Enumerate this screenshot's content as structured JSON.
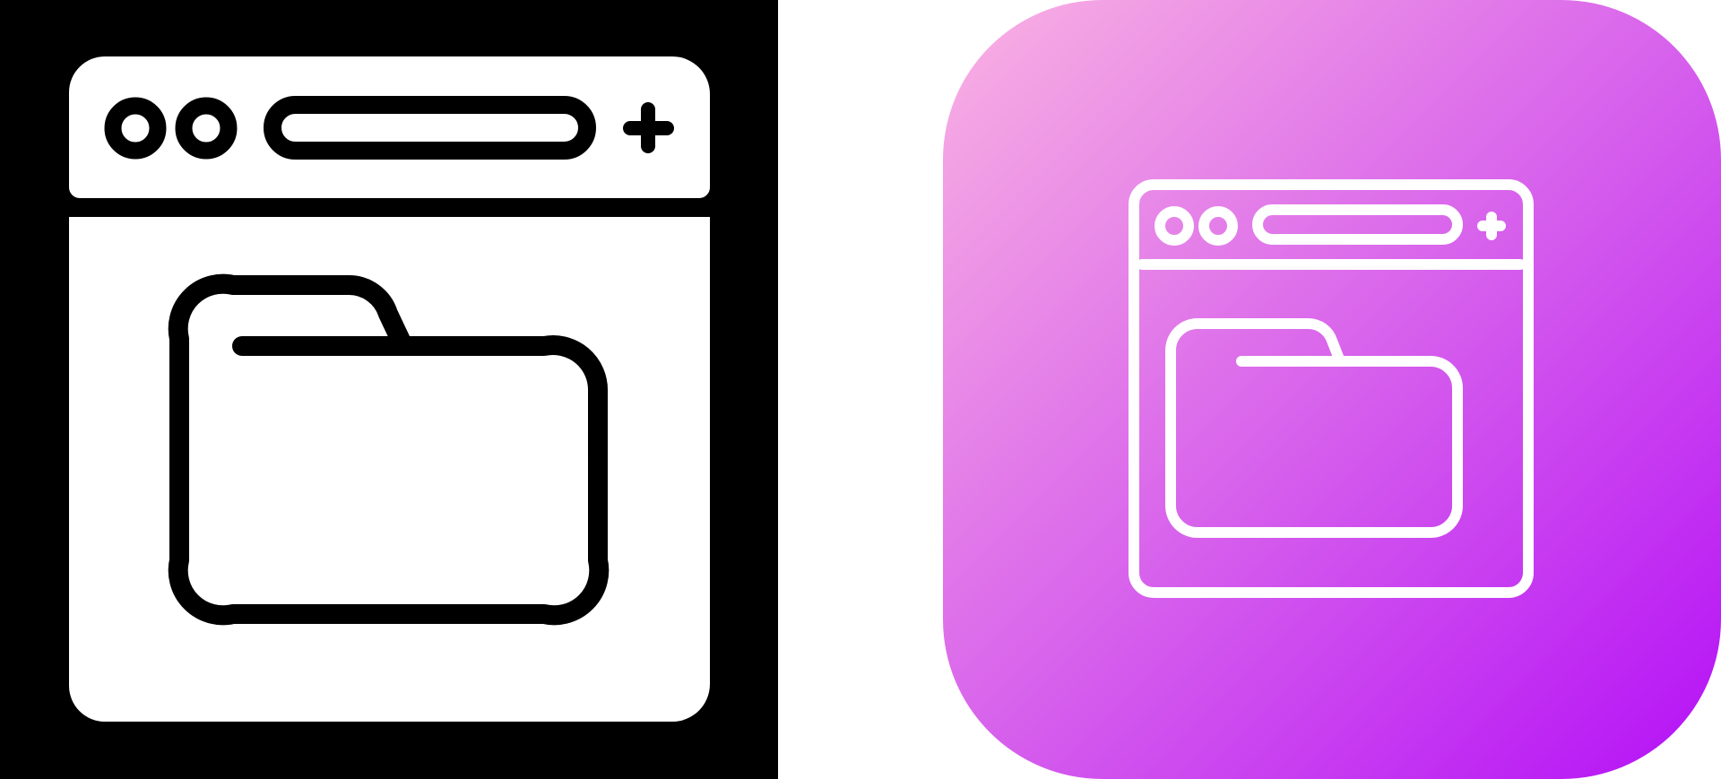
{
  "icons": [
    {
      "name": "browser-folder-icon",
      "style": "glyph",
      "background_color": "#000000",
      "foreground_color": "#ffffff"
    },
    {
      "name": "browser-folder-icon",
      "style": "line",
      "gradient_start_color": "#fab3e2",
      "gradient_end_color": "#b410f6",
      "foreground_color": "#ffffff"
    }
  ]
}
